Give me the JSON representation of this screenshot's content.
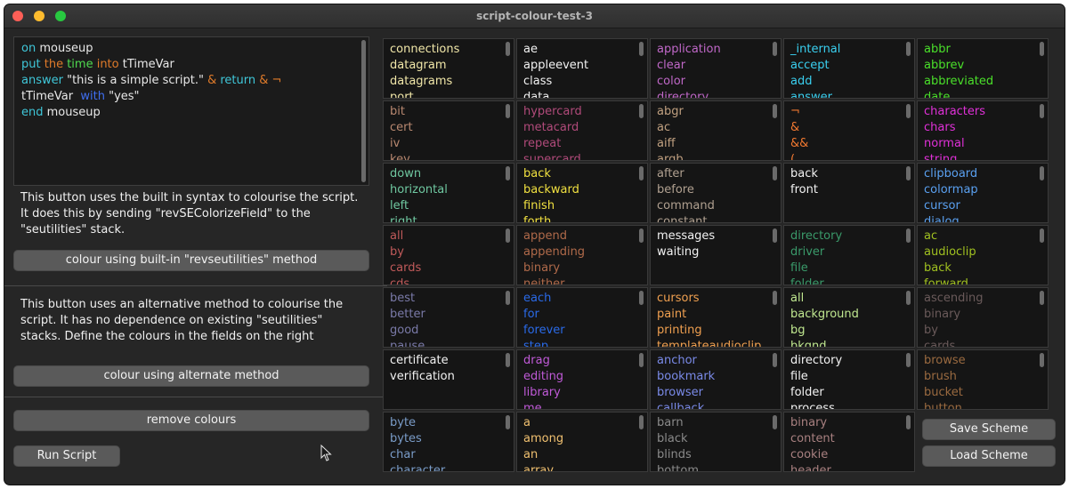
{
  "window": {
    "title": "script-colour-test-3"
  },
  "script": {
    "lines": [
      [
        {
          "t": "on",
          "c": "#3fc7d9"
        },
        {
          "t": " mouseup",
          "c": "#e8e8e8"
        }
      ],
      [
        {
          "t": "put",
          "c": "#3fc7d9"
        },
        {
          "t": " the",
          "c": "#e07b2a"
        },
        {
          "t": " time",
          "c": "#4fdb4f"
        },
        {
          "t": " into",
          "c": "#e07b2a"
        },
        {
          "t": " tTimeVar",
          "c": "#e8e8e8"
        }
      ],
      [
        {
          "t": "answer",
          "c": "#3fc7d9"
        },
        {
          "t": " \"this is a simple script.\"",
          "c": "#e8e8e8"
        },
        {
          "t": " &",
          "c": "#e07b2a"
        },
        {
          "t": " return",
          "c": "#3fc7d9"
        },
        {
          "t": " &",
          "c": "#e07b2a"
        },
        {
          "t": " ¬",
          "c": "#e07b2a"
        }
      ],
      [
        {
          "t": "tTimeVar ",
          "c": "#e8e8e8"
        },
        {
          "t": " with",
          "c": "#3f6ef0"
        },
        {
          "t": " \"yes\"",
          "c": "#e8e8e8"
        }
      ],
      [
        {
          "t": "end",
          "c": "#3fc7d9"
        },
        {
          "t": " mouseup",
          "c": "#e8e8e8"
        }
      ]
    ]
  },
  "left": {
    "desc1": "This button uses the built in syntax to colourise the script. It does this by sending \"revSEColorizeField\" to the \"seutilities\" stack.",
    "btn_builtin": "colour using built-in \"revseutilities\" method",
    "desc2": "This button uses an alternative method to colourise the script. It has no dependence on existing \"seutilities\" stacks. Define the colours in the fields on the right",
    "btn_alternate": "colour using alternate method",
    "btn_remove": "remove colours",
    "btn_run": "Run Script"
  },
  "right": {
    "save_label": "Save Scheme",
    "load_label": "Load Scheme",
    "columns": [
      [
        {
          "color": "#f0e6a8",
          "words": [
            "connections",
            "datagram",
            "datagrams",
            "port"
          ]
        },
        {
          "color": "#b88870",
          "words": [
            "bit",
            "cert",
            "iv",
            "key"
          ]
        },
        {
          "color": "#6fc7a0",
          "words": [
            "down",
            "horizontal",
            "left",
            "right"
          ]
        },
        {
          "color": "#c05a5a",
          "words": [
            "all",
            "by",
            "cards",
            "cds"
          ]
        },
        {
          "color": "#7a7aa8",
          "words": [
            "best",
            "better",
            "good",
            "pause"
          ]
        },
        {
          "color": "#f2f2f2",
          "words": [
            "certificate",
            "verification"
          ]
        },
        {
          "color": "#7a9cc8",
          "words": [
            "byte",
            "bytes",
            "char",
            "character"
          ]
        }
      ],
      [
        {
          "color": "#f2f2f2",
          "words": [
            "ae",
            "appleevent",
            "class",
            "data"
          ]
        },
        {
          "color": "#b04a7a",
          "words": [
            "hypercard",
            "metacard",
            "repeat",
            "supercard"
          ]
        },
        {
          "color": "#f0e040",
          "words": [
            "back",
            "backward",
            "finish",
            "forth"
          ]
        },
        {
          "color": "#b06a4a",
          "words": [
            "append",
            "appending",
            "binary",
            "neither"
          ]
        },
        {
          "color": "#2a6ae8",
          "words": [
            "each",
            "for",
            "forever",
            "step"
          ]
        },
        {
          "color": "#c05ad8",
          "words": [
            "drag",
            "editing",
            "library",
            "me"
          ]
        },
        {
          "color": "#f0c070",
          "words": [
            "a",
            "among",
            "an",
            "array"
          ]
        }
      ],
      [
        {
          "color": "#c068c8",
          "words": [
            "application",
            "clear",
            "color",
            "directory"
          ]
        },
        {
          "color": "#c0a080",
          "words": [
            "abgr",
            "ac",
            "aiff",
            "argb"
          ]
        },
        {
          "color": "#b0a090",
          "words": [
            "after",
            "before",
            "command",
            "constant"
          ]
        },
        {
          "color": "#f2f2f2",
          "words": [
            "messages",
            "waiting"
          ]
        },
        {
          "color": "#f0a050",
          "words": [
            "cursors",
            "paint",
            "printing",
            "templateaudioclip"
          ]
        },
        {
          "color": "#7a8ae8",
          "words": [
            "anchor",
            "bookmark",
            "browser",
            "callback"
          ]
        },
        {
          "color": "#8a8a8a",
          "words": [
            "barn",
            "black",
            "blinds",
            "bottom"
          ]
        }
      ],
      [
        {
          "color": "#3ad0f0",
          "words": [
            "_internal",
            "accept",
            "add",
            "answer"
          ]
        },
        {
          "color": "#f07830",
          "words": [
            "¬",
            "&",
            "&&",
            "("
          ]
        },
        {
          "color": "#f2f2f2",
          "words": [
            "back",
            "front"
          ]
        },
        {
          "color": "#3a9a6a",
          "words": [
            "directory",
            "driver",
            "file",
            "folder"
          ]
        },
        {
          "color": "#c0e890",
          "words": [
            "all",
            "background",
            "bg",
            "bkgnd"
          ]
        },
        {
          "color": "#f2f2f2",
          "words": [
            "directory",
            "file",
            "folder",
            "process"
          ]
        },
        {
          "color": "#a88080",
          "words": [
            "binary",
            "content",
            "cookie",
            "header"
          ]
        }
      ],
      [
        {
          "color": "#4ae02a",
          "words": [
            "abbr",
            "abbrev",
            "abbreviated",
            "date"
          ]
        },
        {
          "color": "#e030d8",
          "words": [
            "characters",
            "chars",
            "normal",
            "string"
          ]
        },
        {
          "color": "#5aa0f0",
          "words": [
            "clipboard",
            "colormap",
            "cursor",
            "dialog"
          ]
        },
        {
          "color": "#a0c020",
          "words": [
            "ac",
            "audioclip",
            "back",
            "forward"
          ]
        },
        {
          "color": "#6a5a5a",
          "words": [
            "ascending",
            "binary",
            "by",
            "cards"
          ]
        },
        {
          "color": "#9a6a40",
          "words": [
            "browse",
            "brush",
            "bucket",
            "button"
          ]
        }
      ]
    ]
  }
}
